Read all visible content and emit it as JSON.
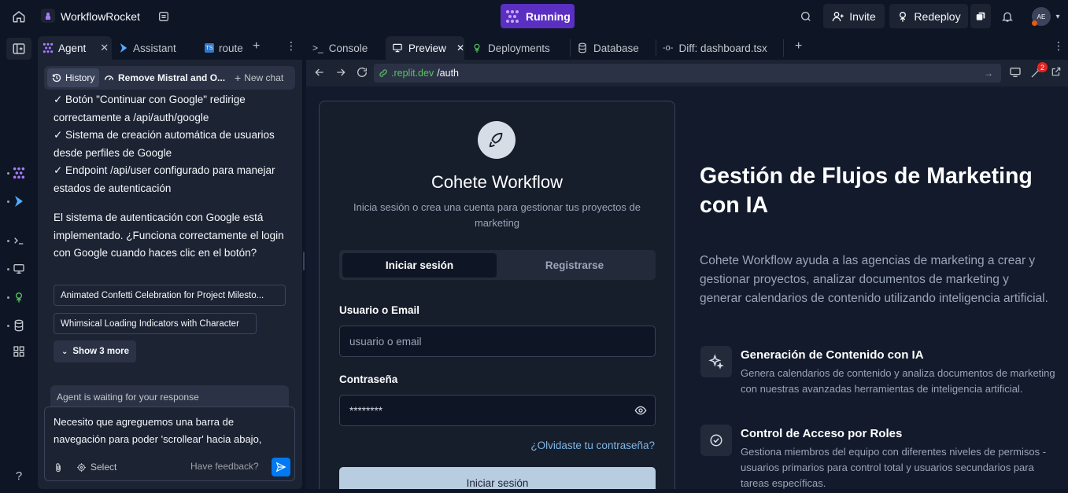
{
  "topbar": {
    "project_name": "WorkflowRocket",
    "run_status": "Running",
    "invite_label": "Invite",
    "redeploy_label": "Redeploy",
    "avatar_initials": "AE",
    "run_color": "#5a2fc2"
  },
  "left_tabs": {
    "agent": "Agent",
    "assistant": "Assistant",
    "routes": "route"
  },
  "chat_header": {
    "history": "History",
    "current_chat": "Remove Mistral and O...",
    "new_chat": "New chat"
  },
  "chat": {
    "lines_1": [
      "✓ Botón \"Continuar con Google\" redirige correctamente a /api/auth/google",
      "✓ Sistema de creación automática de usuarios desde perfiles de Google",
      "✓ Endpoint /api/user configurado para manejar estados de autenticación"
    ],
    "paragraph": "El sistema de autenticación con Google está implementado. ¿Funciona correctamente el login con Google cuando haces clic en el botón?",
    "suggestions": [
      "Animated Confetti Celebration for Project Milesto...",
      "Whimsical Loading Indicators with Character"
    ],
    "show_more": "Show 3 more",
    "waiting": "Agent is waiting for your response",
    "input_text": "Necesito que agreguemos una barra de navegación para poder 'scrollear' hacia abajo,",
    "select_label": "Select",
    "feedback_label": "Have feedback?"
  },
  "right_tabs": {
    "console": "Console",
    "preview": "Preview",
    "deployments": "Deployments",
    "database": "Database",
    "diff": "Diff: dashboard.tsx"
  },
  "url": {
    "host": ".replit.dev",
    "path": "/auth",
    "notification_count": "2"
  },
  "login": {
    "title": "Cohete Workflow",
    "subtitle": "Inicia sesión o crea una cuenta para gestionar tus proyectos de marketing",
    "tab_login": "Iniciar sesión",
    "tab_register": "Registrarse",
    "user_label": "Usuario o Email",
    "user_placeholder": "usuario o email",
    "password_label": "Contraseña",
    "password_value": "********",
    "forgot": "¿Olvidaste tu contraseña?",
    "submit": "Iniciar sesión"
  },
  "hero": {
    "title": "Gestión de Flujos de Marketing con IA",
    "description": "Cohete Workflow ayuda a las agencias de marketing a crear y gestionar proyectos, analizar documentos de marketing y generar calendarios de contenido utilizando inteligencia artificial.",
    "features": [
      {
        "icon": "sparkles-icon",
        "title": "Generación de Contenido con IA",
        "description": "Genera calendarios de contenido y analiza documentos de marketing con nuestras avanzadas herramientas de inteligencia artificial."
      },
      {
        "icon": "check-circle-icon",
        "title": "Control de Acceso por Roles",
        "description": "Gestiona miembros del equipo con diferentes niveles de permisos - usuarios primarios para control total y usuarios secundarios para tareas específicas."
      }
    ]
  }
}
